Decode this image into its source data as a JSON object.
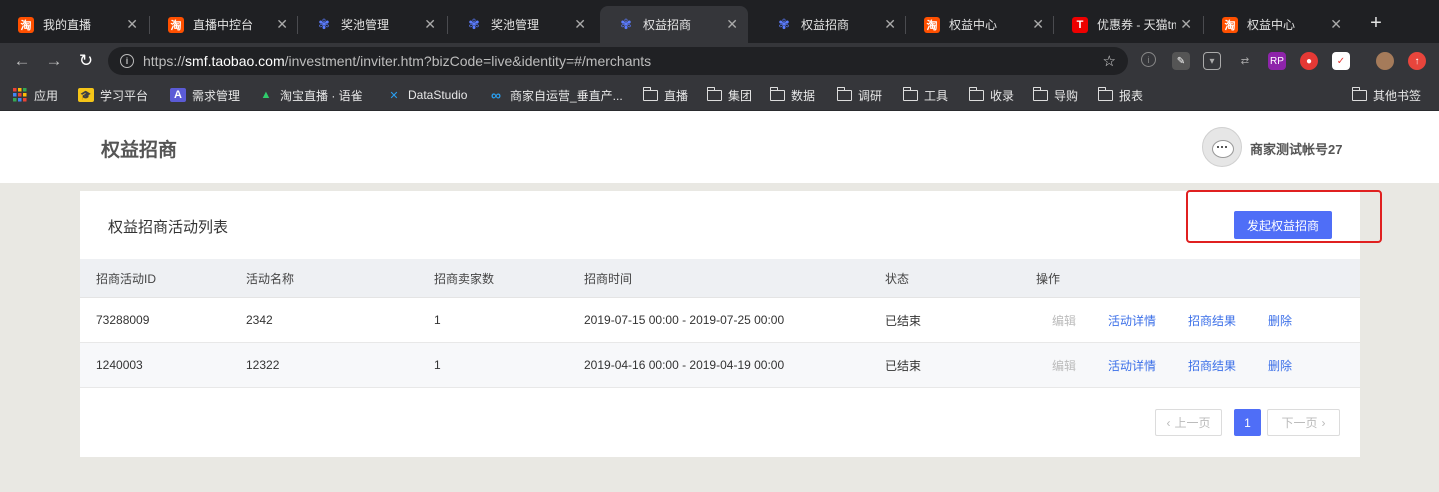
{
  "browser": {
    "tabs": [
      {
        "label": "我的直播",
        "icon": "taobao-icon",
        "fav": "淘",
        "type": "tb"
      },
      {
        "label": "直播中控台",
        "icon": "taobao-icon",
        "fav": "淘",
        "type": "tb"
      },
      {
        "label": "奖池管理",
        "icon": "workflow-icon",
        "fav": "✾",
        "type": "tp"
      },
      {
        "label": "奖池管理",
        "icon": "workflow-icon",
        "fav": "✾",
        "type": "tp"
      },
      {
        "label": "权益招商",
        "icon": "workflow-icon",
        "fav": "✾",
        "type": "tp",
        "active": true
      },
      {
        "label": "权益招商",
        "icon": "workflow-icon",
        "fav": "✾",
        "type": "tp"
      },
      {
        "label": "权益中心",
        "icon": "taobao-icon",
        "fav": "淘",
        "type": "tb"
      },
      {
        "label": "优惠券 - 天猫tm",
        "icon": "tmall-icon",
        "fav": "T",
        "type": "tm"
      },
      {
        "label": "权益中心",
        "icon": "taobao-icon",
        "fav": "淘",
        "type": "tb"
      }
    ],
    "url_prefix": "https://",
    "url_domain": "smf.taobao.com",
    "url_path": "/investment/inviter.htm?bizCode=live&identity=#/merchants",
    "bookmarks": [
      {
        "label": "应用",
        "kind": "apps"
      },
      {
        "label": "学习平台",
        "kind": "site"
      },
      {
        "label": "需求管理",
        "kind": "site"
      },
      {
        "label": "淘宝直播 · 语雀",
        "kind": "site"
      },
      {
        "label": "DataStudio",
        "kind": "site"
      },
      {
        "label": "商家自运营_垂直产...",
        "kind": "site"
      },
      {
        "label": "直播",
        "kind": "folder"
      },
      {
        "label": "集团",
        "kind": "folder"
      },
      {
        "label": "数据",
        "kind": "folder"
      },
      {
        "label": "调研",
        "kind": "folder"
      },
      {
        "label": "工具",
        "kind": "folder"
      },
      {
        "label": "收录",
        "kind": "folder"
      },
      {
        "label": "导购",
        "kind": "folder"
      },
      {
        "label": "报表",
        "kind": "folder"
      }
    ],
    "other_bookmarks": "其他书签"
  },
  "header": {
    "title": "权益招商",
    "account": "商家测试帐号27"
  },
  "main": {
    "title": "权益招商活动列表",
    "create_button": "发起权益招商",
    "columns": [
      "招商活动ID",
      "活动名称",
      "招商卖家数",
      "招商时间",
      "状态",
      "操作"
    ],
    "rows": [
      {
        "id": "73288009",
        "name": "2342",
        "sellers": "1",
        "time": "2019-07-15 00:00 - 2019-07-25 00:00",
        "status": "已结束"
      },
      {
        "id": "1240003",
        "name": "12322",
        "sellers": "1",
        "time": "2019-04-16 00:00 - 2019-04-19 00:00",
        "status": "已结束"
      }
    ],
    "actions": {
      "edit": "编辑",
      "detail": "活动详情",
      "result": "招商结果",
      "delete": "删除"
    },
    "pagination": {
      "prev": "上一页",
      "current": "1",
      "next": "下一页"
    }
  },
  "colors": {
    "accent": "#4f6ef7",
    "link": "#3b6fe8",
    "highlight": "#e02020"
  }
}
